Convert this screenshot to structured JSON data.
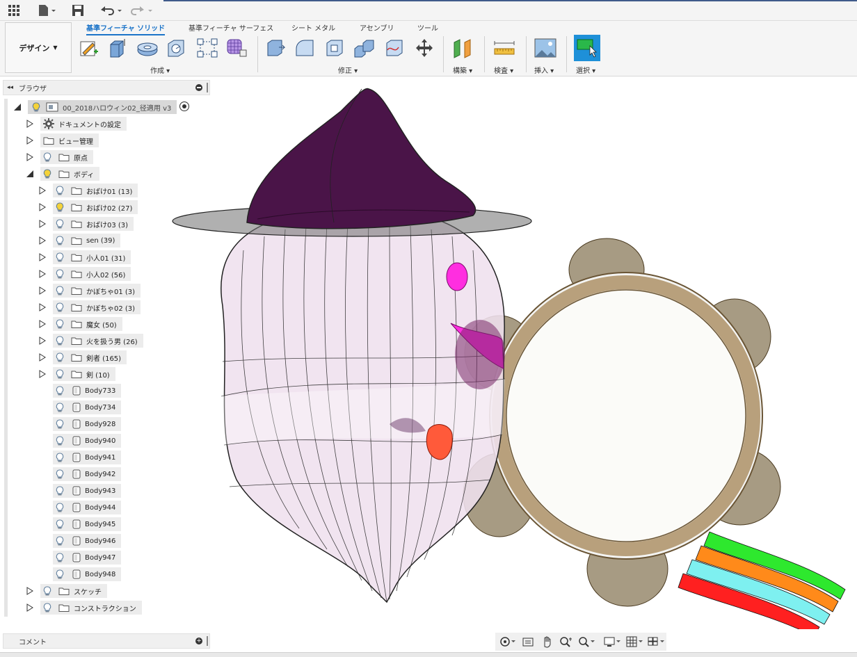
{
  "topbar": {
    "icons": [
      "app-grid-icon",
      "file-icon",
      "save-icon",
      "undo-icon",
      "redo-icon"
    ]
  },
  "ribbon": {
    "design_label": "デザイン",
    "tabs": [
      {
        "label": "基準フィーチャ ソリッド",
        "active": true
      },
      {
        "label": "基準フィーチャ サーフェス",
        "active": false
      },
      {
        "label": "シート メタル",
        "active": false
      },
      {
        "label": "アセンブリ",
        "active": false
      },
      {
        "label": "ツール",
        "active": false
      }
    ],
    "groups": {
      "create": "作成",
      "modify": "修正",
      "construct": "構築",
      "inspect": "検査",
      "insert": "挿入",
      "select": "選択"
    }
  },
  "browser": {
    "title": "ブラウザ",
    "root": "00_2018ハロウィン02_径適用 v3",
    "items": [
      {
        "label": "ドキュメントの設定",
        "icon": "gear"
      },
      {
        "label": "ビュー管理",
        "icon": "folder"
      },
      {
        "label": "原点",
        "icon": "folder"
      },
      {
        "label": "ボディ",
        "icon": "folder"
      }
    ],
    "folders": [
      "おばけ01 (13)",
      "おばけ02 (27)",
      "おばけ03 (3)",
      "sen (39)",
      "小人01 (31)",
      "小人02 (56)",
      "かぼちゃ01 (3)",
      "かぼちゃ02 (3)",
      "魔女 (50)",
      "火を扱う男 (26)",
      "剣者 (165)",
      "剣 (10)"
    ],
    "bodies": [
      "Body733",
      "Body734",
      "Body928",
      "Body940",
      "Body941",
      "Body942",
      "Body943",
      "Body944",
      "Body945",
      "Body946",
      "Body947",
      "Body948"
    ],
    "tail": [
      "スケッチ",
      "コンストラクション"
    ]
  },
  "comment": {
    "label": "コメント"
  },
  "colors": {
    "accent": "#1a73c8",
    "hat": "#4a1448",
    "selected_tool": "#1e90d8"
  }
}
